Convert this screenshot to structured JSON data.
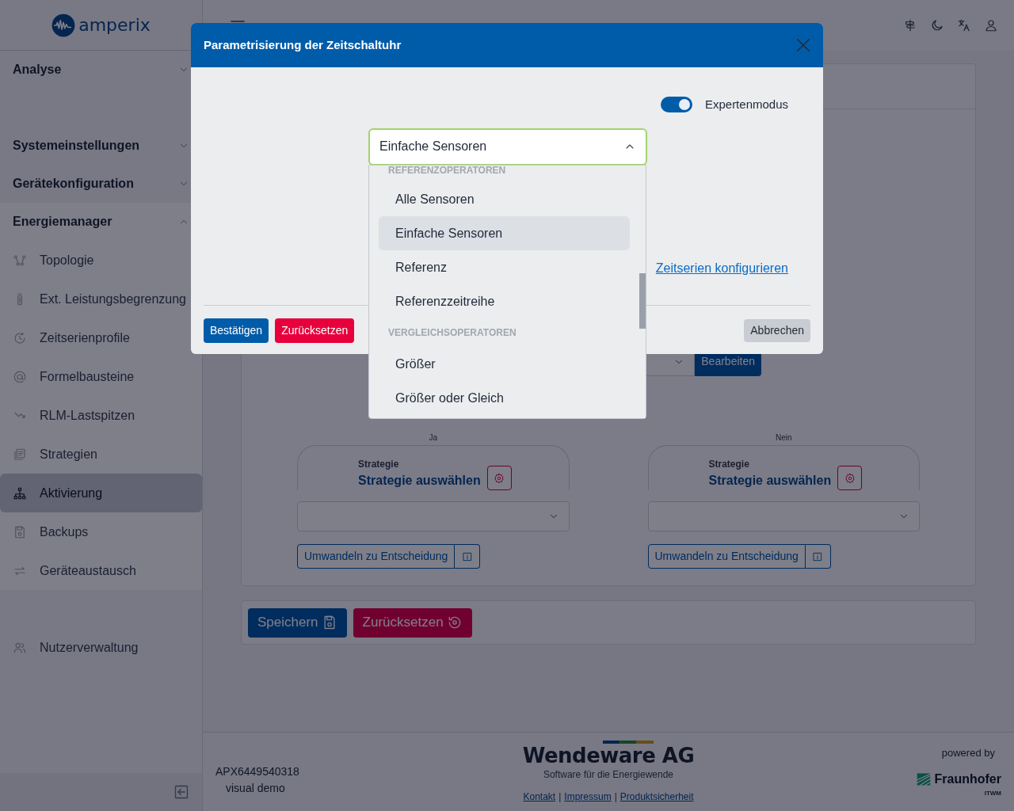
{
  "brand": {
    "name": "amperix"
  },
  "sidebar": {
    "sections": [
      {
        "label": "Analyse",
        "expanded": false
      },
      {
        "label": "Systemeinstellungen",
        "expanded": false
      },
      {
        "label": "Gerätekonfiguration",
        "expanded": false
      },
      {
        "label": "Energiemanager",
        "expanded": true,
        "children": [
          {
            "label": "Topologie",
            "selected": false
          },
          {
            "label": "Ext. Leistungsbegrenzung",
            "selected": false
          },
          {
            "label": "Zeitserienprofile",
            "selected": false
          },
          {
            "label": "Formelbausteine",
            "selected": false
          },
          {
            "label": "RLM-Lastspitzen",
            "selected": false
          },
          {
            "label": "Strategien",
            "selected": false
          },
          {
            "label": "Aktivierung",
            "selected": true
          },
          {
            "label": "Backups",
            "selected": false
          },
          {
            "label": "Geräteaustausch",
            "selected": false
          }
        ]
      }
    ],
    "user_item": {
      "label": "Nutzerverwaltung"
    }
  },
  "page": {
    "edit_button": "Bearbeiten",
    "branches": [
      {
        "label": "Ja",
        "caption": "Strategie",
        "title": "Strategie auswählen",
        "convert_button": "Umwandeln zu Entscheidung"
      },
      {
        "label": "Nein",
        "caption": "Strategie",
        "title": "Strategie auswählen",
        "convert_button": "Umwandeln zu Entscheidung"
      }
    ],
    "save_button": "Speichern",
    "reset_button": "Zurücksetzen"
  },
  "footer": {
    "device_id": "APX6449540318",
    "mode": "visual demo",
    "company": "Wendeware AG",
    "tagline": "Software für die Energiewende",
    "links": [
      "Kontakt",
      "Impressum",
      "Produktsicherheit"
    ],
    "link_separators": [
      "|",
      "|"
    ],
    "powered_by": "powered by",
    "partner": "Fraunhofer",
    "partner_unit": "ITWM"
  },
  "dialog": {
    "title": "Parametrisierung der Zeitschaltuhr",
    "expert_mode": {
      "label": "Expertenmodus",
      "on": true
    },
    "select": {
      "value": "Einfache Sensoren",
      "expanded": true
    },
    "options": [
      {
        "kind": "group",
        "label": "REFERENZOPERATOREN"
      },
      {
        "kind": "option",
        "label": "Alle Sensoren",
        "selected": false
      },
      {
        "kind": "option",
        "label": "Einfache Sensoren",
        "selected": true
      },
      {
        "kind": "option",
        "label": "Referenz",
        "selected": false
      },
      {
        "kind": "option",
        "label": "Referenzzeitreihe",
        "selected": false
      },
      {
        "kind": "group",
        "label": "VERGLEICHSOPERATOREN"
      },
      {
        "kind": "option",
        "label": "Größer",
        "selected": false
      },
      {
        "kind": "option",
        "label": "Größer oder Gleich",
        "selected": false
      }
    ],
    "link": "Zeitserien konfigurieren",
    "confirm_button": "Bestätigen",
    "reset_button": "Zurücksetzen",
    "cancel_button": "Abbrechen"
  }
}
